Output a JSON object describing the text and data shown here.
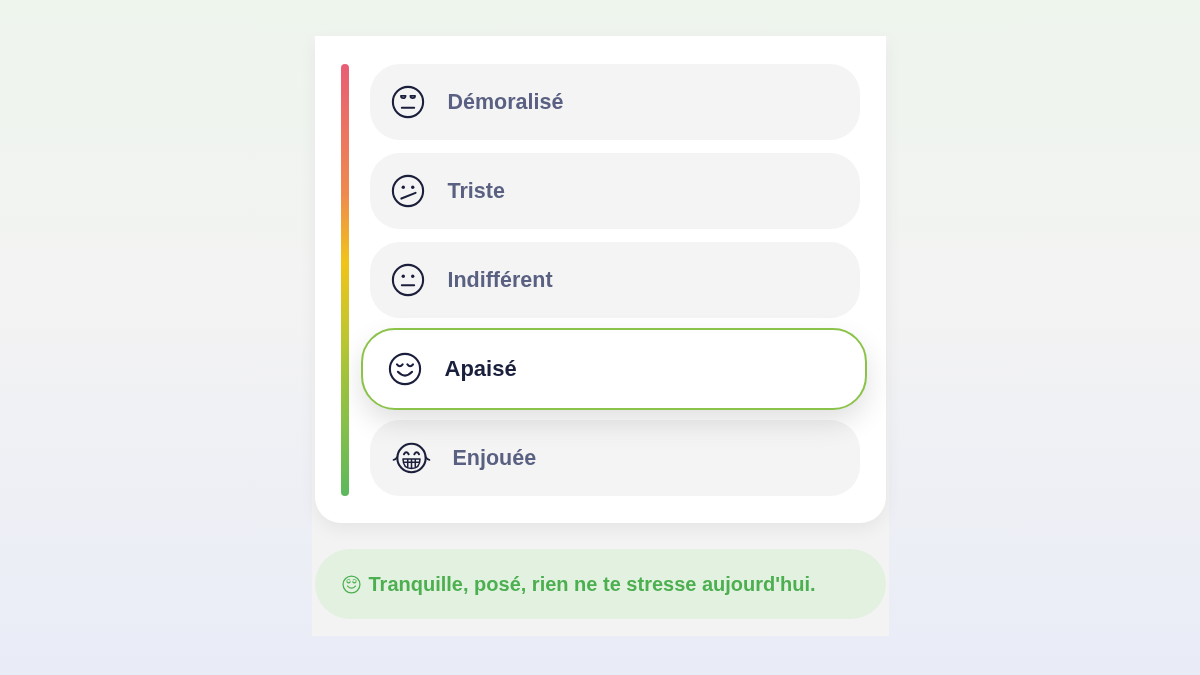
{
  "moods": [
    {
      "label": "Démoralisé",
      "kind": "downcast",
      "selected": false
    },
    {
      "label": "Triste",
      "kind": "confused",
      "selected": false
    },
    {
      "label": "Indifférent",
      "kind": "neutral",
      "selected": false
    },
    {
      "label": "Apaisé",
      "kind": "relieved",
      "selected": true
    },
    {
      "label": "Enjouée",
      "kind": "laughing",
      "selected": false
    }
  ],
  "message": {
    "text": "Tranquille, posé, rien ne te stresse aujourd'hui."
  }
}
